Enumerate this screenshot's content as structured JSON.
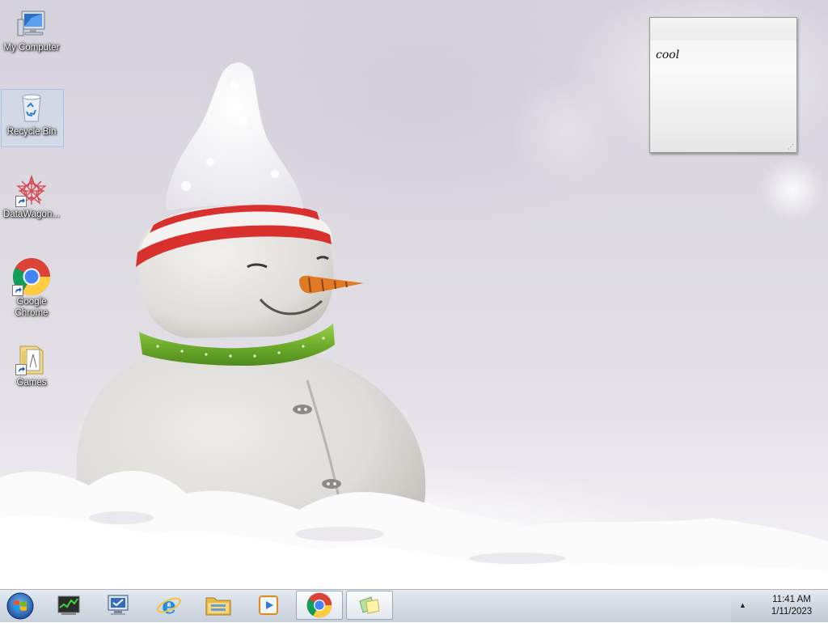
{
  "desktop": {
    "icons": [
      {
        "label": "My Computer",
        "icon": "computer-icon"
      },
      {
        "label": "Recycle Bin",
        "icon": "recycle-bin-icon"
      },
      {
        "label": "DataWagon...",
        "icon": "datawagon-icon"
      },
      {
        "label": "Google Chrome",
        "icon": "chrome-icon"
      },
      {
        "label": "Games",
        "icon": "games-folder-icon"
      }
    ]
  },
  "sticky_note": {
    "text": "cool"
  },
  "taskbar": {
    "start_icon": "windows-start-orb",
    "buttons": [
      {
        "name": "task-manager",
        "icon": "task-manager-icon"
      },
      {
        "name": "remote-desktop",
        "icon": "remote-desktop-icon"
      },
      {
        "name": "internet-explorer",
        "icon": "internet-explorer-icon"
      },
      {
        "name": "file-explorer",
        "icon": "folder-icon"
      },
      {
        "name": "media-player",
        "icon": "media-player-icon"
      },
      {
        "name": "google-chrome",
        "icon": "chrome-icon",
        "active": true
      },
      {
        "name": "sticky-notes",
        "icon": "sticky-notes-icon",
        "active": true
      }
    ],
    "tray": {
      "show_hidden_icon": "chevron-up-icon",
      "time": "11:41 AM",
      "date": "1/11/2023"
    }
  }
}
